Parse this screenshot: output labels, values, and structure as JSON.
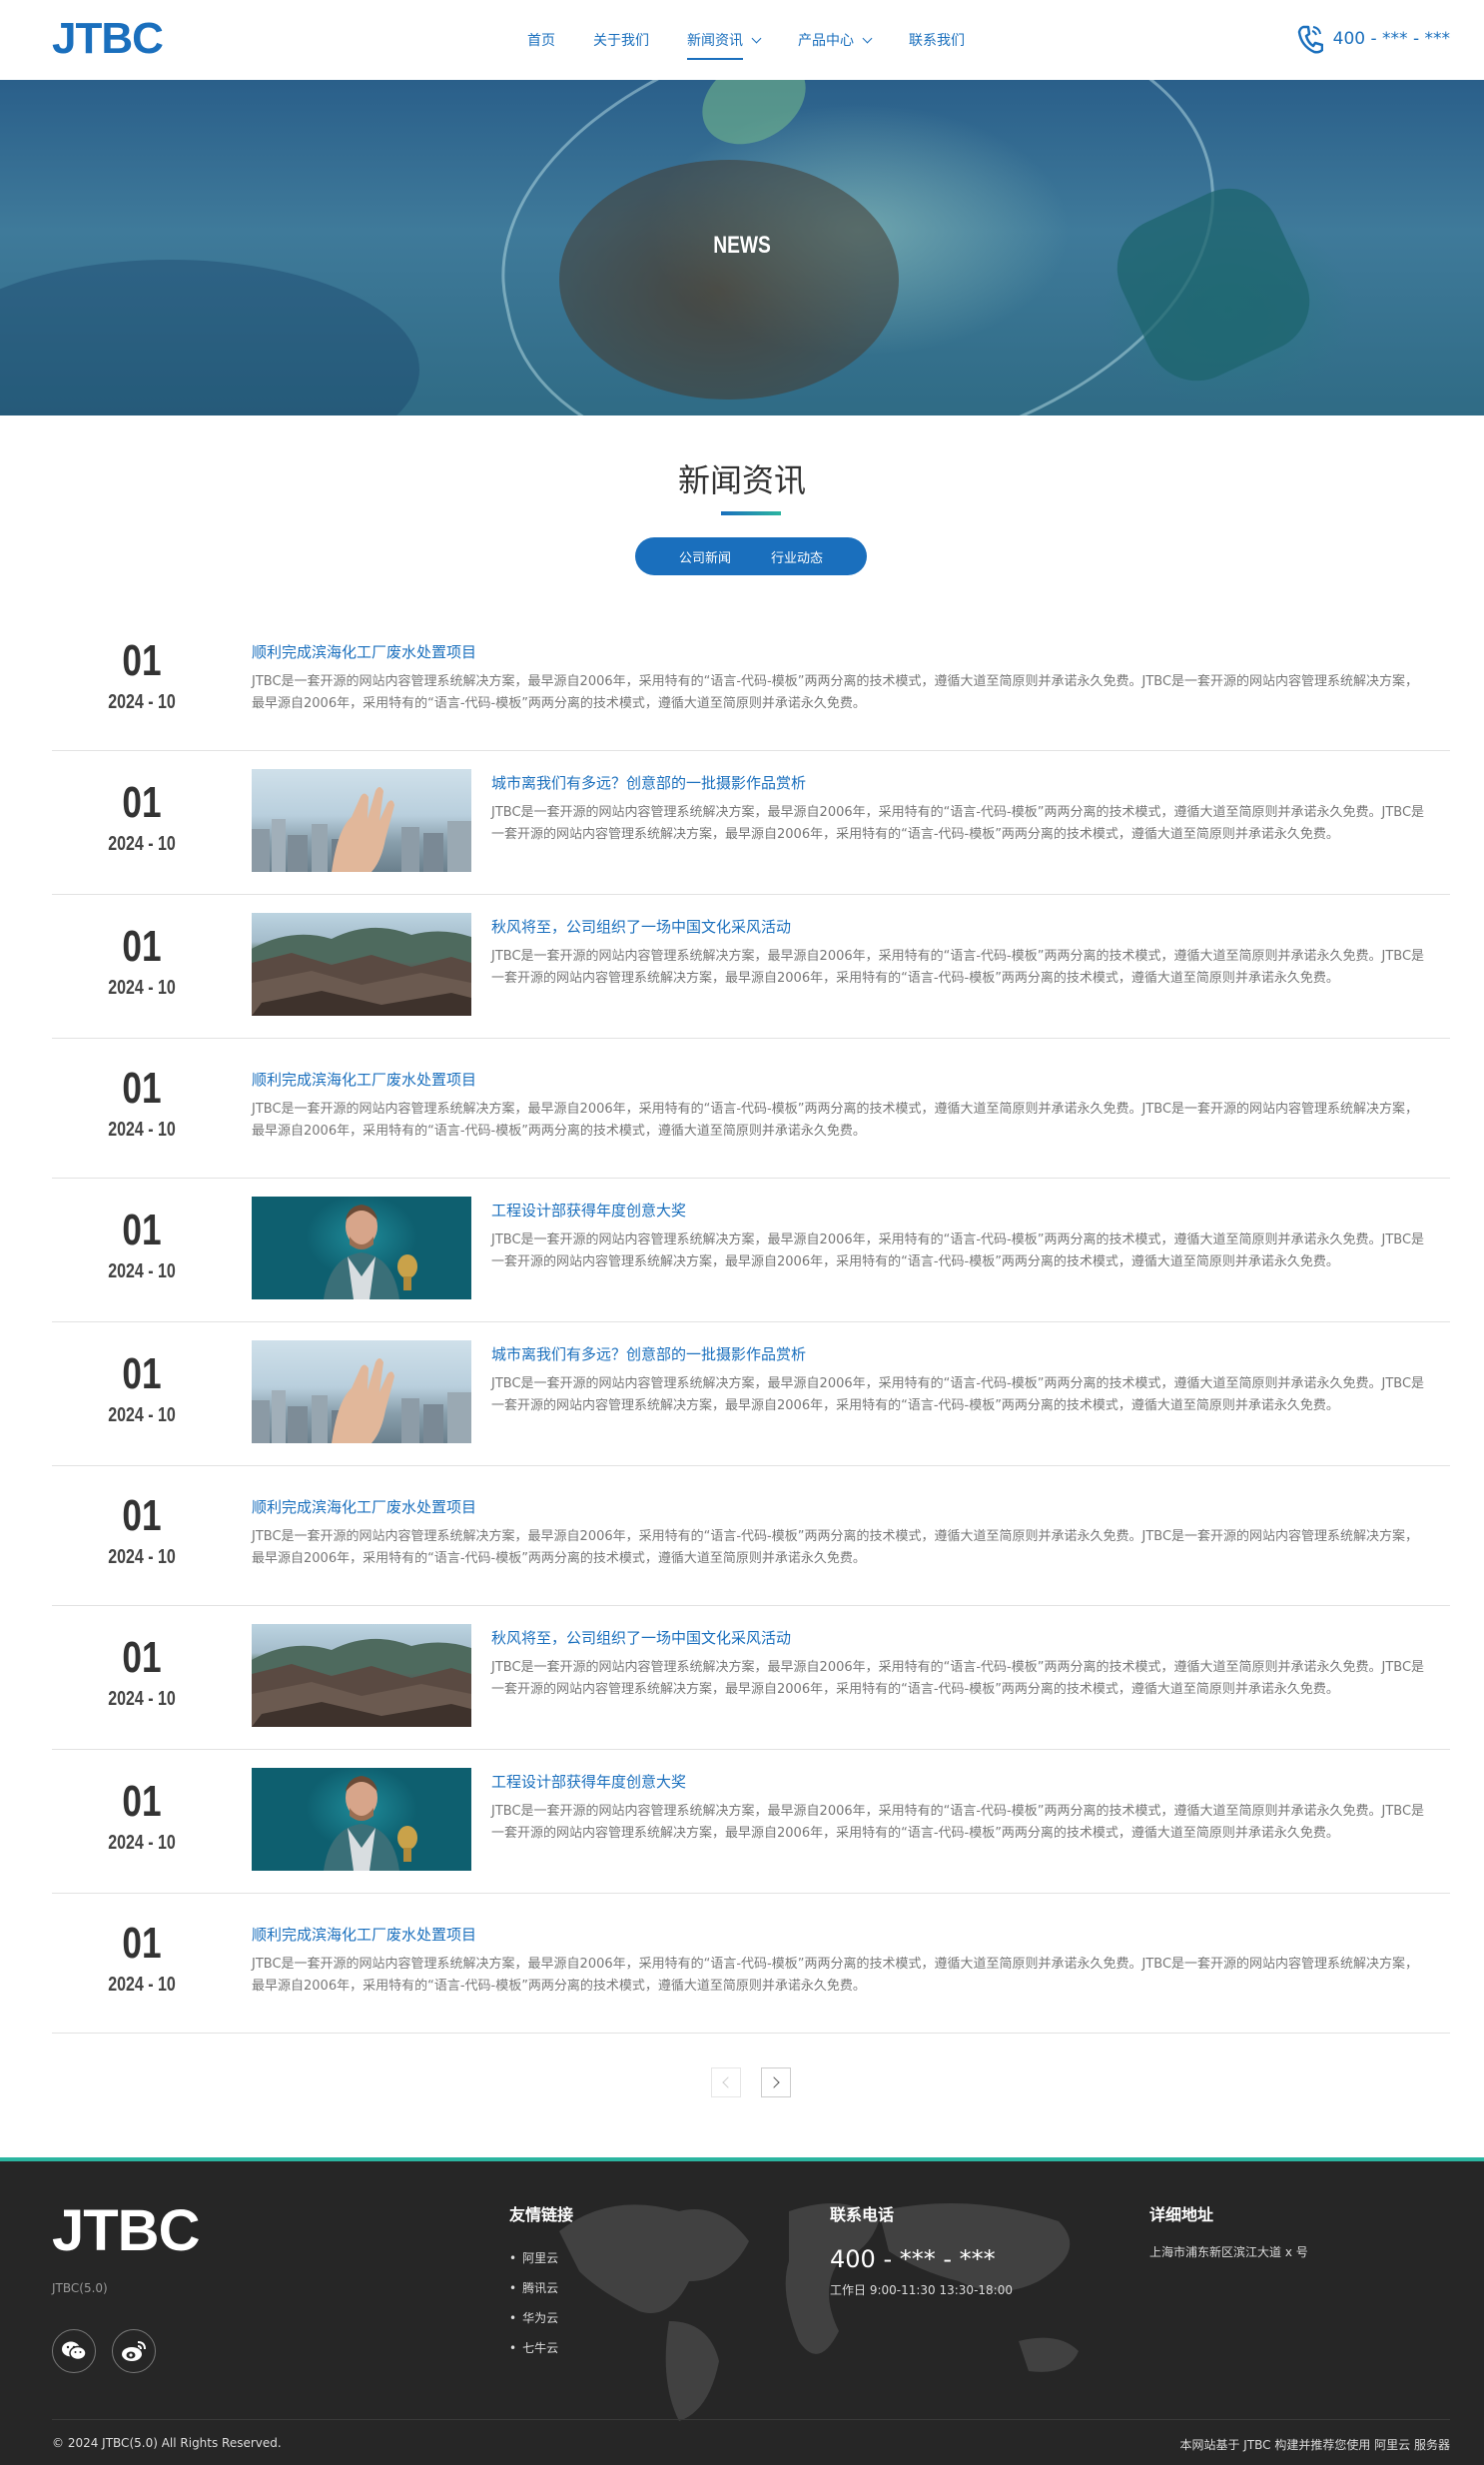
{
  "header": {
    "logo": "JTBC",
    "nav": [
      "首页",
      "关于我们",
      "新闻资讯",
      "产品中心",
      "联系我们"
    ],
    "active_nav": "新闻资讯",
    "phone": "400 - *** - ***"
  },
  "banner": {
    "title": "NEWS"
  },
  "section": {
    "title": "新闻资讯",
    "tabs": [
      "公司新闻",
      "行业动态"
    ]
  },
  "news": [
    {
      "day": "01",
      "ym": "2024 - 10",
      "title": "顺利完成滨海化工厂废水处置项目",
      "image": "",
      "desc": "JTBC是一套开源的网站内容管理系统解决方案，最早源自2006年，采用特有的“语言-代码-模板”两两分离的技术模式，遵循大道至简原则并承诺永久免费。JTBC是一套开源的网站内容管理系统解决方案，最早源自2006年，采用特有的“语言-代码-模板”两两分离的技术模式，遵循大道至简原则并承诺永久免费。"
    },
    {
      "day": "01",
      "ym": "2024 - 10",
      "title": "城市离我们有多远？创意部的一批摄影作品赏析",
      "image": "city",
      "desc": "JTBC是一套开源的网站内容管理系统解决方案，最早源自2006年，采用特有的“语言-代码-模板”两两分离的技术模式，遵循大道至简原则并承诺永久免费。JTBC是一套开源的网站内容管理系统解决方案，最早源自2006年，采用特有的“语言-代码-模板”两两分离的技术模式，遵循大道至简原则并承诺永久免费。"
    },
    {
      "day": "01",
      "ym": "2024 - 10",
      "title": "秋风将至，公司组织了一场中国文化采风活动",
      "image": "hill",
      "desc": "JTBC是一套开源的网站内容管理系统解决方案，最早源自2006年，采用特有的“语言-代码-模板”两两分离的技术模式，遵循大道至简原则并承诺永久免费。JTBC是一套开源的网站内容管理系统解决方案，最早源自2006年，采用特有的“语言-代码-模板”两两分离的技术模式，遵循大道至简原则并承诺永久免费。"
    },
    {
      "day": "01",
      "ym": "2024 - 10",
      "title": "顺利完成滨海化工厂废水处置项目",
      "image": "",
      "desc": "JTBC是一套开源的网站内容管理系统解决方案，最早源自2006年，采用特有的“语言-代码-模板”两两分离的技术模式，遵循大道至简原则并承诺永久免费。JTBC是一套开源的网站内容管理系统解决方案，最早源自2006年，采用特有的“语言-代码-模板”两两分离的技术模式，遵循大道至简原则并承诺永久免费。"
    },
    {
      "day": "01",
      "ym": "2024 - 10",
      "title": "工程设计部获得年度创意大奖",
      "image": "man",
      "desc": "JTBC是一套开源的网站内容管理系统解决方案，最早源自2006年，采用特有的“语言-代码-模板”两两分离的技术模式，遵循大道至简原则并承诺永久免费。JTBC是一套开源的网站内容管理系统解决方案，最早源自2006年，采用特有的“语言-代码-模板”两两分离的技术模式，遵循大道至简原则并承诺永久免费。"
    },
    {
      "day": "01",
      "ym": "2024 - 10",
      "title": "城市离我们有多远？创意部的一批摄影作品赏析",
      "image": "city",
      "desc": "JTBC是一套开源的网站内容管理系统解决方案，最早源自2006年，采用特有的“语言-代码-模板”两两分离的技术模式，遵循大道至简原则并承诺永久免费。JTBC是一套开源的网站内容管理系统解决方案，最早源自2006年，采用特有的“语言-代码-模板”两两分离的技术模式，遵循大道至简原则并承诺永久免费。"
    },
    {
      "day": "01",
      "ym": "2024 - 10",
      "title": "顺利完成滨海化工厂废水处置项目",
      "image": "",
      "desc": "JTBC是一套开源的网站内容管理系统解决方案，最早源自2006年，采用特有的“语言-代码-模板”两两分离的技术模式，遵循大道至简原则并承诺永久免费。JTBC是一套开源的网站内容管理系统解决方案，最早源自2006年，采用特有的“语言-代码-模板”两两分离的技术模式，遵循大道至简原则并承诺永久免费。"
    },
    {
      "day": "01",
      "ym": "2024 - 10",
      "title": "秋风将至，公司组织了一场中国文化采风活动",
      "image": "hill",
      "desc": "JTBC是一套开源的网站内容管理系统解决方案，最早源自2006年，采用特有的“语言-代码-模板”两两分离的技术模式，遵循大道至简原则并承诺永久免费。JTBC是一套开源的网站内容管理系统解决方案，最早源自2006年，采用特有的“语言-代码-模板”两两分离的技术模式，遵循大道至简原则并承诺永久免费。"
    },
    {
      "day": "01",
      "ym": "2024 - 10",
      "title": "工程设计部获得年度创意大奖",
      "image": "man",
      "desc": "JTBC是一套开源的网站内容管理系统解决方案，最早源自2006年，采用特有的“语言-代码-模板”两两分离的技术模式，遵循大道至简原则并承诺永久免费。JTBC是一套开源的网站内容管理系统解决方案，最早源自2006年，采用特有的“语言-代码-模板”两两分离的技术模式，遵循大道至简原则并承诺永久免费。"
    },
    {
      "day": "01",
      "ym": "2024 - 10",
      "title": "顺利完成滨海化工厂废水处置项目",
      "image": "",
      "desc": "JTBC是一套开源的网站内容管理系统解决方案，最早源自2006年，采用特有的“语言-代码-模板”两两分离的技术模式，遵循大道至简原则并承诺永久免费。JTBC是一套开源的网站内容管理系统解决方案，最早源自2006年，采用特有的“语言-代码-模板”两两分离的技术模式，遵循大道至简原则并承诺永久免费。"
    }
  ],
  "footer": {
    "logo": "JTBC",
    "version": "JTBC(5.0)",
    "links_title": "友情链接",
    "links": [
      "阿里云",
      "腾讯云",
      "华为云",
      "七牛云"
    ],
    "contact_title": "联系电话",
    "phone": "400 - *** - ***",
    "hours": "工作日 9:00-11:30 13:30-18:00",
    "address_title": "详细地址",
    "address": "上海市浦东新区滨江大道 x 号",
    "copyright": "© 2024 JTBC(5.0) All Rights Reserved.",
    "powered": "本网站基于 JTBC 构建并推荐您使用 阿里云 服务器"
  },
  "colors": {
    "brand": "#1a6fbd",
    "accent": "#2bb5a0",
    "footer_bg": "#262626"
  }
}
